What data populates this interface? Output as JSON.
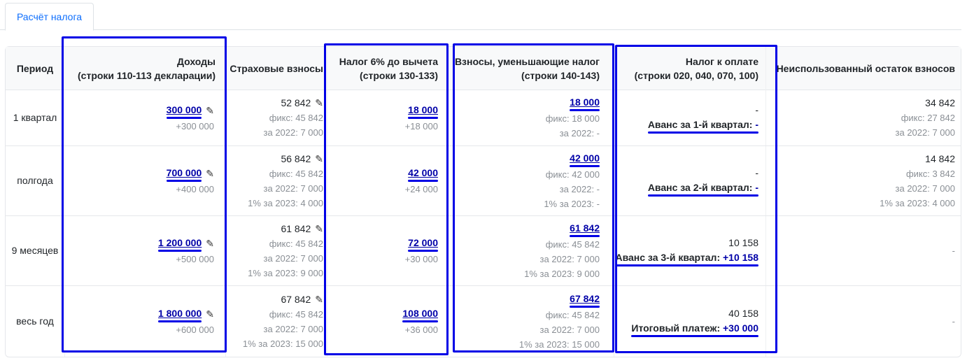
{
  "tabs": [
    {
      "label": "Расчёт налога"
    }
  ],
  "headers": {
    "period": "Период",
    "income_l1": "Доходы",
    "income_l2": "(строки 110-113 декларации)",
    "insurance": "Страховые взносы",
    "tax6_l1": "Налог 6% до вычета",
    "tax6_l2": "(строки 130-133)",
    "reducing_l1": "Взносы, уменьшающие налог",
    "reducing_l2": "(строки 140-143)",
    "topay_l1": "Налог к оплате",
    "topay_l2": "(строки 020, 040, 070, 100)",
    "unused": "Неиспользованный остаток взносов"
  },
  "rows": [
    {
      "period": "1 квартал",
      "income": "300 000",
      "income_delta": "+300 000",
      "ins_total": "52 842",
      "ins_lines": [
        "фикс: 45 842",
        "за 2022: 7 000"
      ],
      "tax6": "18 000",
      "tax6_delta": "+18 000",
      "red_total": "18 000",
      "red_lines": [
        "фикс: 18 000",
        "за 2022: -"
      ],
      "pay_value": "-",
      "pay_label": "Аванс за 1-й квартал:",
      "pay_amount": "-",
      "unused_total": "34 842",
      "unused_lines": [
        "фикс: 27 842",
        "за 2022: 7 000"
      ]
    },
    {
      "period": "полгода",
      "income": "700 000",
      "income_delta": "+400 000",
      "ins_total": "56 842",
      "ins_lines": [
        "фикс: 45 842",
        "за 2022: 7 000",
        "1% за 2023: 4 000"
      ],
      "tax6": "42 000",
      "tax6_delta": "+24 000",
      "red_total": "42 000",
      "red_lines": [
        "фикс: 42 000",
        "за 2022: -",
        "1% за 2023: -"
      ],
      "pay_value": "-",
      "pay_label": "Аванс за 2-й квартал:",
      "pay_amount": "-",
      "unused_total": "14 842",
      "unused_lines": [
        "фикс: 3 842",
        "за 2022: 7 000",
        "1% за 2023: 4 000"
      ]
    },
    {
      "period": "9 месяцев",
      "income": "1 200 000",
      "income_delta": "+500 000",
      "ins_total": "61 842",
      "ins_lines": [
        "фикс: 45 842",
        "за 2022: 7 000",
        "1% за 2023: 9 000"
      ],
      "tax6": "72 000",
      "tax6_delta": "+30 000",
      "red_total": "61 842",
      "red_lines": [
        "фикс: 45 842",
        "за 2022: 7 000",
        "1% за 2023: 9 000"
      ],
      "pay_value": "10 158",
      "pay_label": "Аванс за 3-й квартал:",
      "pay_amount": "+10 158",
      "unused_total": "-",
      "unused_lines": []
    },
    {
      "period": "весь год",
      "income": "1 800 000",
      "income_delta": "+600 000",
      "ins_total": "67 842",
      "ins_lines": [
        "фикс: 45 842",
        "за 2022: 7 000",
        "1% за 2023: 15 000"
      ],
      "tax6": "108 000",
      "tax6_delta": "+36 000",
      "red_total": "67 842",
      "red_lines": [
        "фикс: 45 842",
        "за 2022: 7 000",
        "1% за 2023: 15 000"
      ],
      "pay_value": "40 158",
      "pay_label": "Итоговый платеж:",
      "pay_amount": "+30 000",
      "unused_total": "-",
      "unused_lines": []
    }
  ],
  "icons": {
    "edit": "pencil-icon"
  },
  "colors": {
    "link": "#0000a8",
    "highlight": "#0000e6",
    "tab": "#0d6efd"
  }
}
